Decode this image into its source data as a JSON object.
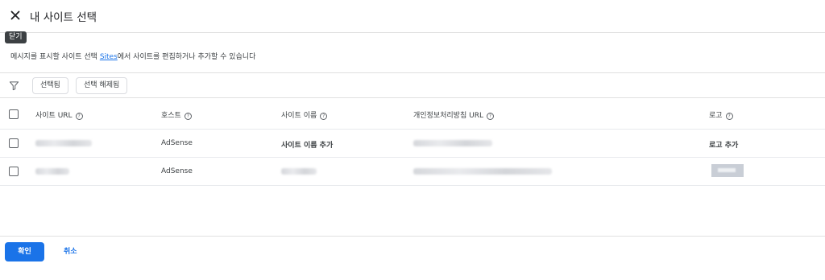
{
  "header": {
    "title": "내 사이트 선택",
    "close_icon": "close-icon"
  },
  "tooltip": {
    "text": "닫기"
  },
  "description": {
    "before": "메시지를 표시할 사이트 선택 ",
    "link": "Sites",
    "after": "에서 사이트를 편집하거나 추가할 수 있습니다"
  },
  "filters": {
    "selected": "선택됨",
    "deselect": "선택 해제됨"
  },
  "table": {
    "columns": {
      "url": "사이트 URL",
      "host": "호스트",
      "name": "사이트 이름",
      "privacy": "개인정보처리방침 URL",
      "logo": "로고"
    },
    "rows": [
      {
        "host": "AdSense",
        "name_action": "사이트 이름 추가",
        "logo_action": "로고 추가"
      },
      {
        "host": "AdSense"
      }
    ]
  },
  "footer": {
    "confirm": "확인",
    "cancel": "취소"
  },
  "colors": {
    "accent": "#1a73e8",
    "border": "#e0e0e0"
  }
}
